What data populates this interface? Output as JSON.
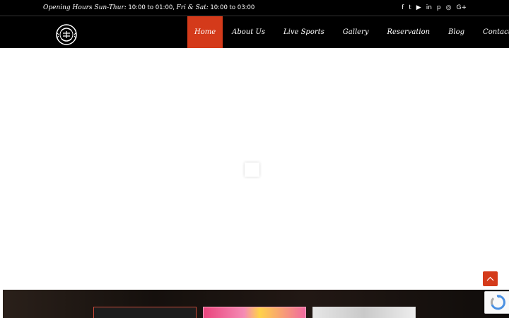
{
  "topbar": {
    "hours_prefix": "Opening Hours Sun-Thur:",
    "hours_weekday": "10:00 to 01:00,",
    "hours_weekend_label": "Fri & Sat:",
    "hours_weekend": "10:00 to 03:00",
    "social": [
      {
        "icon": "facebook-icon",
        "glyph": "f"
      },
      {
        "icon": "twitter-icon",
        "glyph": "t"
      },
      {
        "icon": "youtube-icon",
        "glyph": "▶"
      },
      {
        "icon": "linkedin-icon",
        "glyph": "in"
      },
      {
        "icon": "pinterest-icon",
        "glyph": "p"
      },
      {
        "icon": "instagram-icon",
        "glyph": "◎"
      },
      {
        "icon": "google-plus-icon",
        "glyph": "G+"
      }
    ]
  },
  "nav": {
    "items": [
      {
        "label": "Home",
        "active": true
      },
      {
        "label": "About Us"
      },
      {
        "label": "Live Sports"
      },
      {
        "label": "Gallery"
      },
      {
        "label": "Reservation"
      },
      {
        "label": "Blog"
      },
      {
        "label": "Contact"
      }
    ]
  },
  "colors": {
    "accent": "#d43a1a",
    "bar_bg": "#000000"
  }
}
